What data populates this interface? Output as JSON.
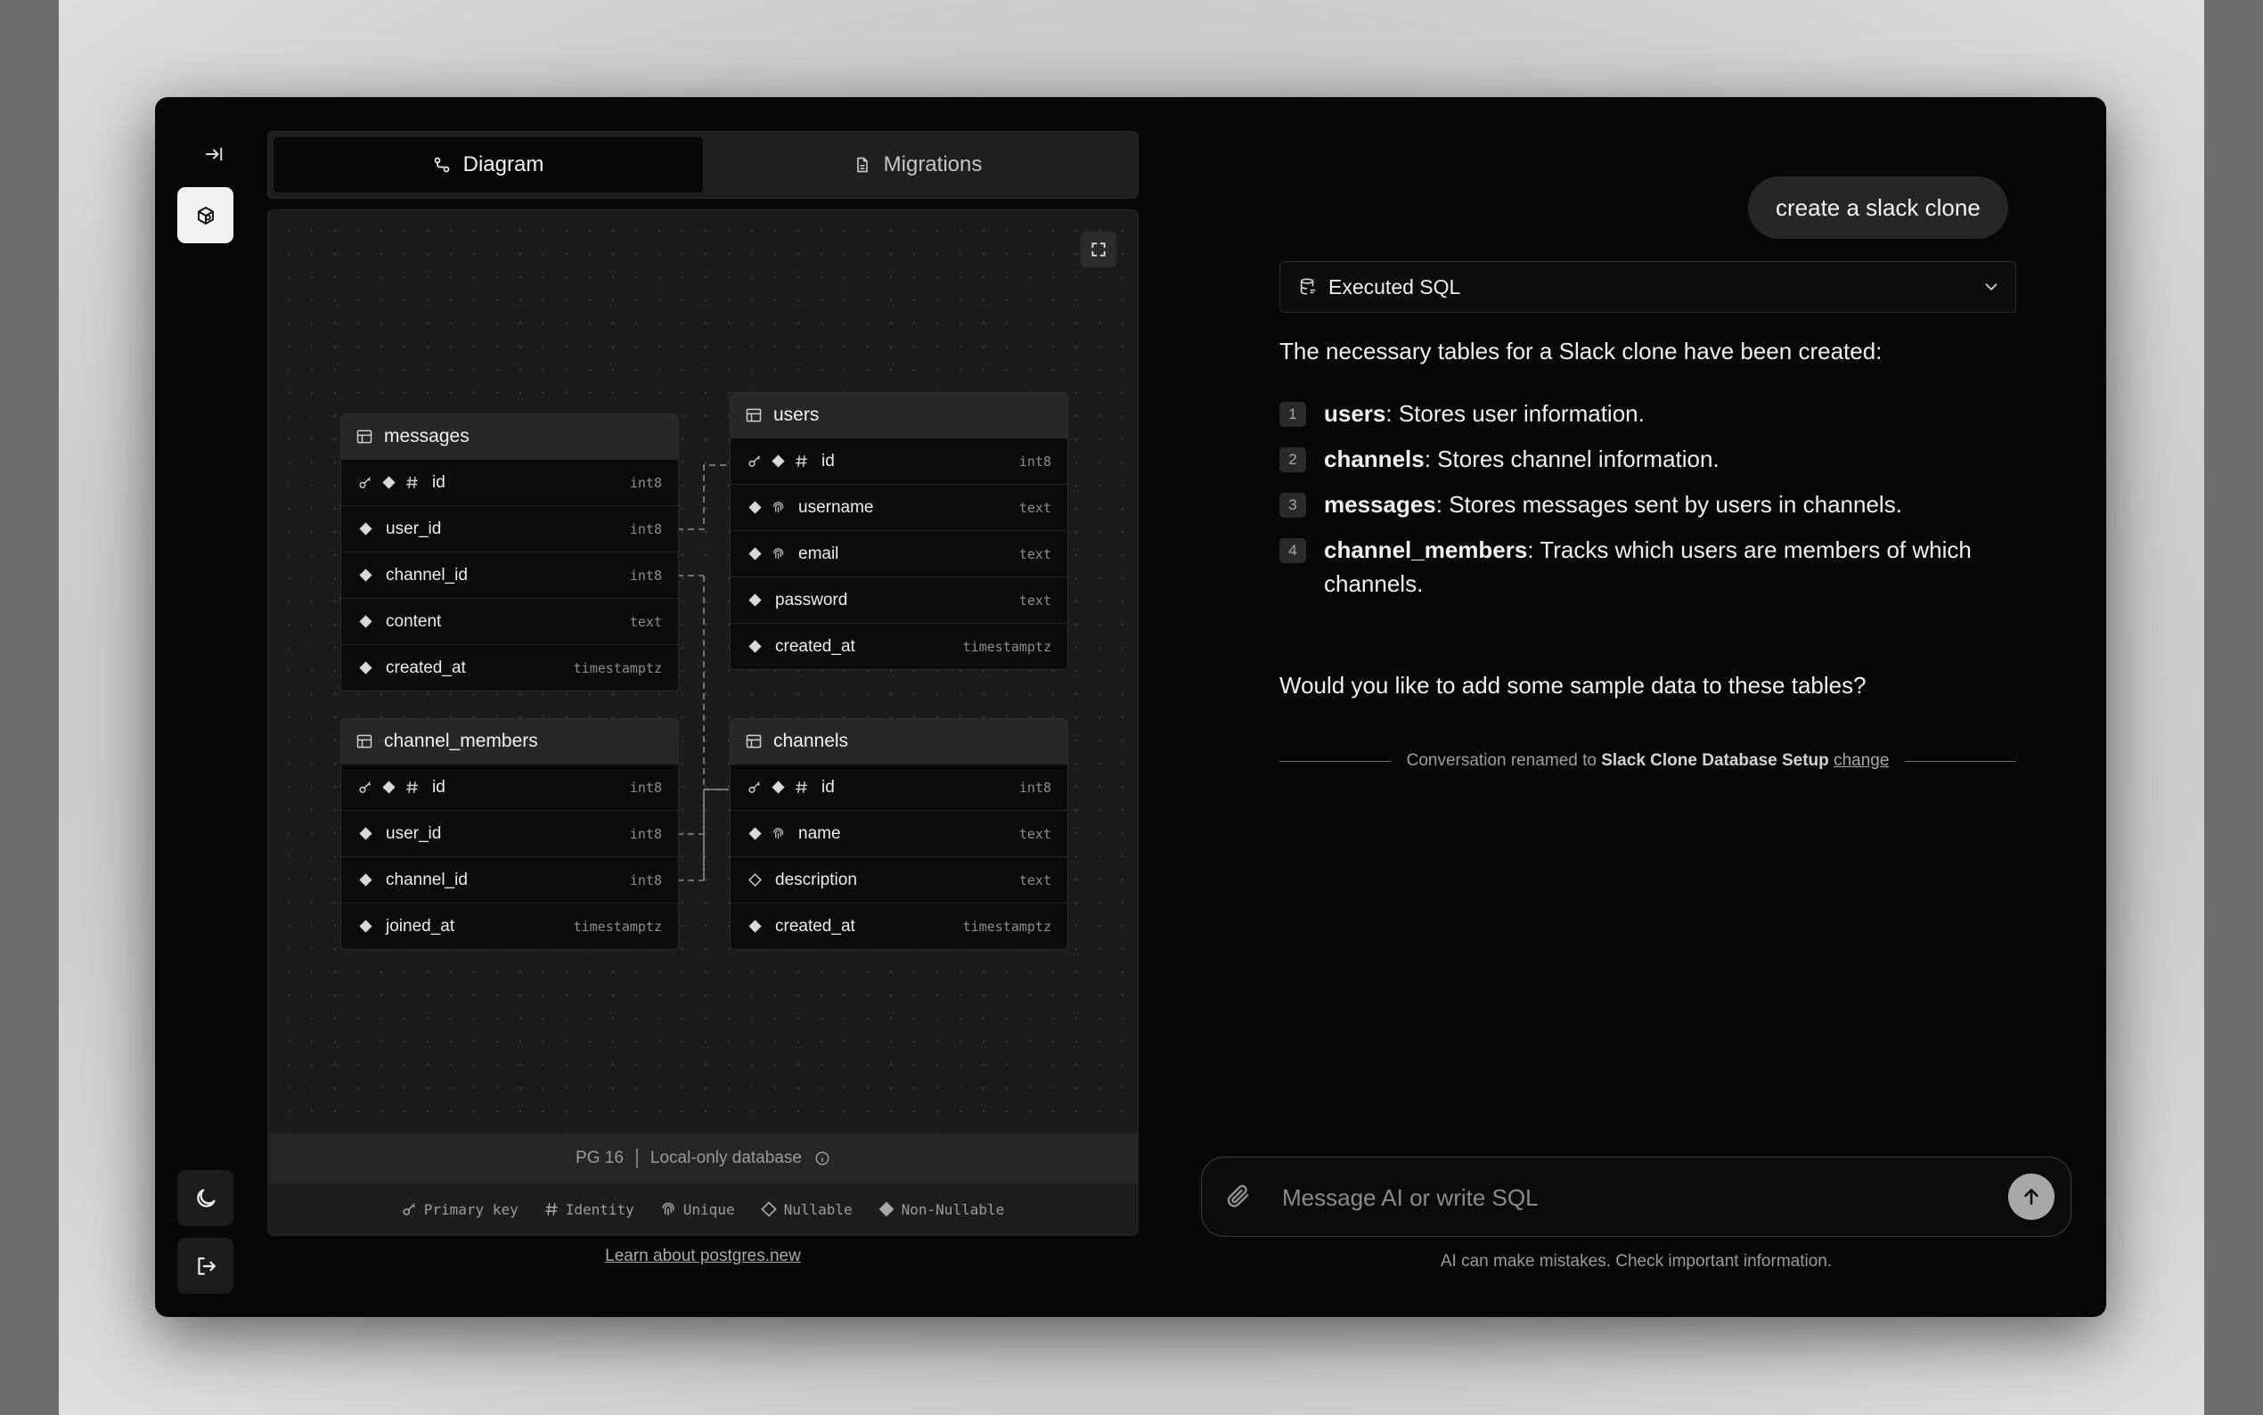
{
  "tabs": {
    "diagram": "Diagram",
    "migrations": "Migrations"
  },
  "tables": {
    "messages": {
      "name": "messages",
      "columns": [
        {
          "name": "id",
          "type": "int8"
        },
        {
          "name": "user_id",
          "type": "int8"
        },
        {
          "name": "channel_id",
          "type": "int8"
        },
        {
          "name": "content",
          "type": "text"
        },
        {
          "name": "created_at",
          "type": "timestamptz"
        }
      ]
    },
    "users": {
      "name": "users",
      "columns": [
        {
          "name": "id",
          "type": "int8"
        },
        {
          "name": "username",
          "type": "text"
        },
        {
          "name": "email",
          "type": "text"
        },
        {
          "name": "password",
          "type": "text"
        },
        {
          "name": "created_at",
          "type": "timestamptz"
        }
      ]
    },
    "channel_members": {
      "name": "channel_members",
      "columns": [
        {
          "name": "id",
          "type": "int8"
        },
        {
          "name": "user_id",
          "type": "int8"
        },
        {
          "name": "channel_id",
          "type": "int8"
        },
        {
          "name": "joined_at",
          "type": "timestamptz"
        }
      ]
    },
    "channels": {
      "name": "channels",
      "columns": [
        {
          "name": "id",
          "type": "int8"
        },
        {
          "name": "name",
          "type": "text"
        },
        {
          "name": "description",
          "type": "text"
        },
        {
          "name": "created_at",
          "type": "timestamptz"
        }
      ]
    }
  },
  "db_info": {
    "version": "PG 16",
    "mode": "Local-only database"
  },
  "legend": {
    "primary_key": "Primary key",
    "identity": "Identity",
    "unique": "Unique",
    "nullable": "Nullable",
    "non_nullable": "Non-Nullable"
  },
  "learn_link": "Learn about postgres.new",
  "chat": {
    "user_message": "create a slack clone",
    "sql_label": "Executed SQL",
    "intro": "The necessary tables for a Slack clone have been created:",
    "items": [
      {
        "num": "1",
        "name": "users",
        "desc": ": Stores user information."
      },
      {
        "num": "2",
        "name": "channels",
        "desc": ": Stores channel information."
      },
      {
        "num": "3",
        "name": "messages",
        "desc": ": Stores messages sent by users in channels."
      },
      {
        "num": "4",
        "name": "channel_members",
        "desc": ": Tracks which users are members of which channels."
      }
    ],
    "question": "Would you like to add some sample data to these tables?",
    "rename_prefix": "Conversation renamed to",
    "rename_title": "Slack Clone Database Setup",
    "rename_action": "change"
  },
  "input": {
    "placeholder": "Message AI or write SQL"
  },
  "disclaimer": "AI can make mistakes. Check important information.",
  "icons": {
    "collapse": "collapse-sidebar-icon",
    "logo": "logo-icon",
    "theme": "moon-icon",
    "logout": "logout-icon"
  }
}
